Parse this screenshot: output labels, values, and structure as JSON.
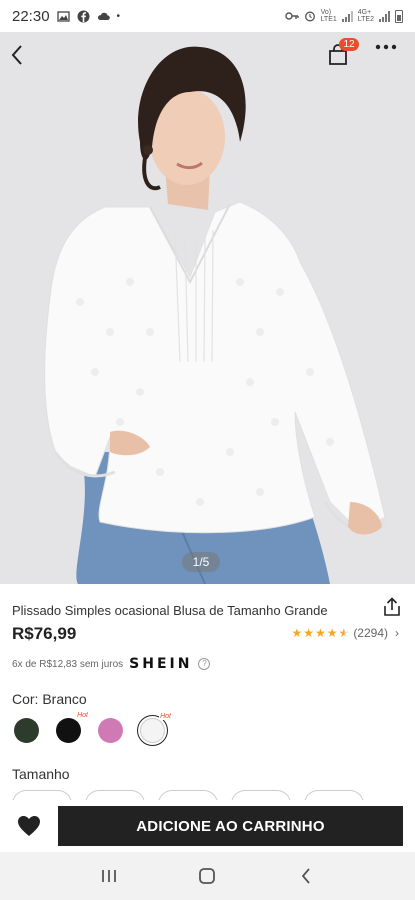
{
  "status_bar": {
    "time": "22:30",
    "net_top": "Vo)",
    "net_bottom": "LTE1",
    "net2_top": "4G+",
    "net2_bottom": "LTE2"
  },
  "header": {
    "cart_count": "12",
    "image_counter": "1/5"
  },
  "product": {
    "title": "Plissado Simples ocasional Blusa de Tamanho Grande",
    "price": "R$76,99",
    "rating_stars": 4.5,
    "reviews": "(2294)",
    "installments": "6x de R$12,83 sem juros",
    "brand": "SHEIN",
    "color_label": "Cor: Branco",
    "size_label": "Tamanho",
    "hot_label": "Hot",
    "swatches": [
      {
        "name": "dark-green",
        "color": "#2c3b2c",
        "hot": false
      },
      {
        "name": "black",
        "color": "#111111",
        "hot": true
      },
      {
        "name": "pink",
        "color": "#d07ab5",
        "hot": false
      },
      {
        "name": "white",
        "color": "#f4f4f4",
        "hot": true,
        "selected": true
      }
    ]
  },
  "actions": {
    "add_to_cart": "ADICIONE AO CARRINHO"
  },
  "icons": {
    "back": "back-arrow-icon",
    "bag": "shopping-bag-icon",
    "more": "more-dots-icon",
    "share": "share-icon",
    "favorite": "heart-icon"
  },
  "colors": {
    "badge": "#e84d2e",
    "star": "#f5a623",
    "cta": "#222222"
  }
}
